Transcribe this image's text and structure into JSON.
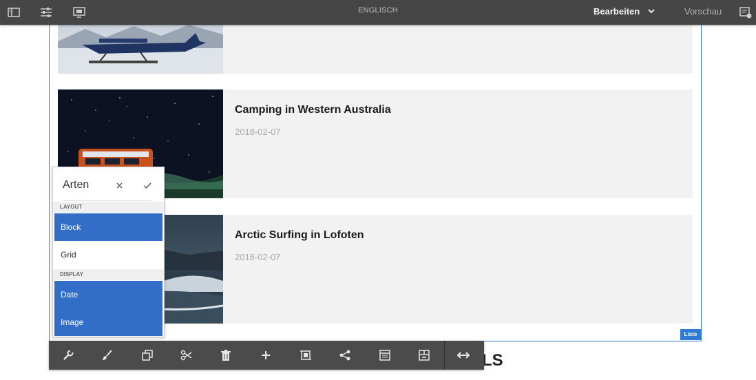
{
  "topbar": {
    "language": "ENGLISCH",
    "mode_label": "Bearbeiten",
    "preview_label": "Vorschau",
    "icons": [
      "side-panel-icon",
      "properties-icon",
      "emulator-icon",
      "annotate-icon"
    ]
  },
  "list": {
    "tag": "Liste",
    "items": [
      {
        "title": "",
        "date": "",
        "image": "seaplane-on-snow"
      },
      {
        "title": "Camping in Western Australia",
        "date": "2018-02-07",
        "image": "van-under-night-sky"
      },
      {
        "title": "Arctic Surfing in Lofoten",
        "date": "2018-02-07",
        "image": "arctic-waves"
      }
    ]
  },
  "styles_popover": {
    "title": "Arten",
    "groups": [
      {
        "header": "LAYOUT",
        "options": [
          {
            "label": "Block",
            "selected": true
          },
          {
            "label": "Grid",
            "selected": false
          }
        ]
      },
      {
        "header": "DISPLAY",
        "options": [
          {
            "label": "Date",
            "selected": true
          },
          {
            "label": "Image",
            "selected": true
          }
        ]
      }
    ]
  },
  "toolbar": {
    "icons": [
      "wrench-icon",
      "brush-icon",
      "copy-icon",
      "cut-icon",
      "trash-icon",
      "plus-icon",
      "crop-icon",
      "share-icon",
      "list-icon",
      "template-icon",
      "resize-icon"
    ]
  },
  "below_heading": "LS",
  "colors": {
    "selection": "#326ec8",
    "frame": "#2d7bd6",
    "topbar": "#464646",
    "toolbar": "#4b4b4b"
  }
}
